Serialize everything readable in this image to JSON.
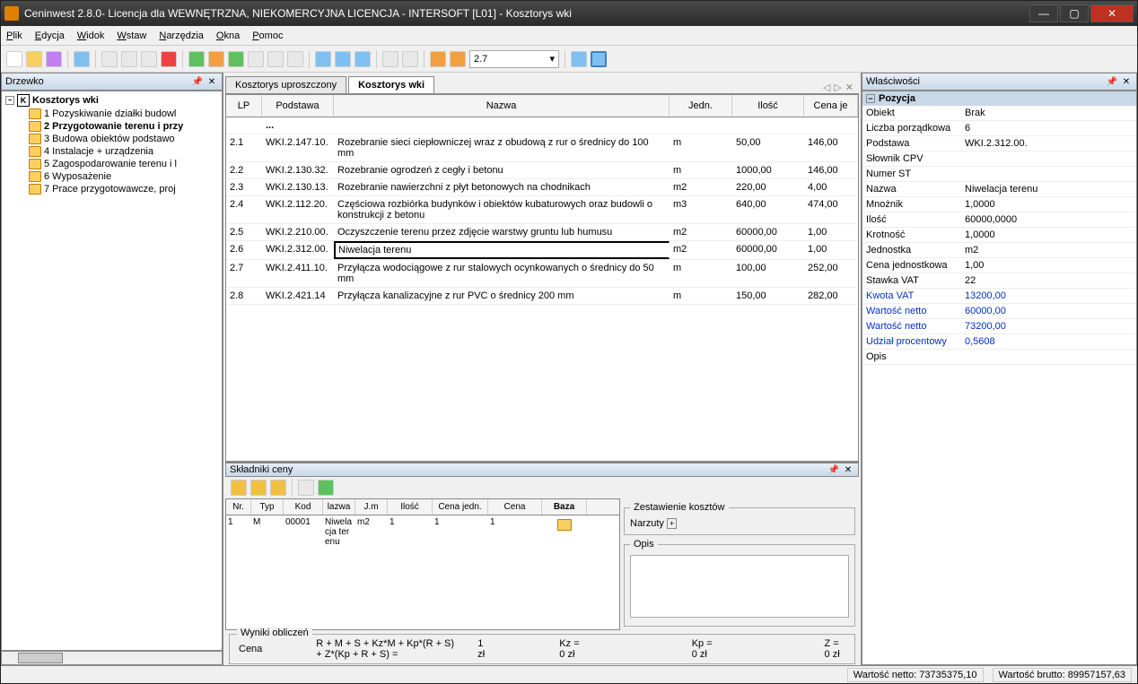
{
  "window": {
    "title": "Ceninwest 2.8.0- Licencja dla WEWNĘTRZNA, NIEKOMERCYJNA LICENCJA - INTERSOFT [L01] - Kosztorys wki"
  },
  "menu": [
    "Plik",
    "Edycja",
    "Widok",
    "Wstaw",
    "Narzędzia",
    "Okna",
    "Pomoc"
  ],
  "toolbar_combo": "2.7",
  "tree": {
    "title": "Drzewko",
    "root": "Kosztorys wki",
    "items": [
      "1 Pozyskiwanie działki budowl",
      "2 Przygotowanie terenu i przy",
      "3 Budowa obiektów podstawo",
      "4 Instalacje + urządzenia",
      "5 Zagospodarowanie terenu i l",
      "6 Wyposażenie",
      "7 Prace przygotowawcze, proj"
    ]
  },
  "tabs": {
    "t1": "Kosztorys uproszczony",
    "t2": "Kosztorys wki"
  },
  "grid": {
    "headers": {
      "lp": "LP",
      "pod": "Podstawa",
      "naz": "Nazwa",
      "jed": "Jedn.",
      "ilo": "Ilość",
      "cen": "Cena je"
    },
    "dots": "...",
    "rows": [
      {
        "lp": "2.1",
        "pod": "WKI.2.147.10.",
        "naz": "Rozebranie sieci ciepłowniczej wraz   z obudową z rur o średnicy do 100 mm",
        "jed": "m",
        "ilo": "50,00",
        "cen": "146,00"
      },
      {
        "lp": "2.2",
        "pod": "WKI.2.130.32.",
        "naz": "Rozebranie ogrodzeń z cegły i betonu",
        "jed": "m",
        "ilo": "1000,00",
        "cen": "146,00"
      },
      {
        "lp": "2.3",
        "pod": "WKI.2.130.13.",
        "naz": "Rozebranie nawierzchni z płyt betonowych na chodnikach",
        "jed": "m2",
        "ilo": "220,00",
        "cen": "4,00"
      },
      {
        "lp": "2.4",
        "pod": "WKI.2.112.20.",
        "naz": "Częściowa rozbiórka budynków i obiektów kubaturowych oraz budowli o konstrukcji z betonu",
        "jed": "m3",
        "ilo": "640,00",
        "cen": "474,00"
      },
      {
        "lp": "2.5",
        "pod": "WKI.2.210.00.",
        "naz": "Oczyszczenie terenu przez zdjęcie warstwy gruntu lub humusu",
        "jed": "m2",
        "ilo": "60000,00",
        "cen": "1,00"
      },
      {
        "lp": "2.6",
        "pod": "WKI.2.312.00.",
        "naz": "Niwelacja terenu",
        "jed": "m2",
        "ilo": "60000,00",
        "cen": "1,00",
        "sel": true
      },
      {
        "lp": "2.7",
        "pod": "WKI.2.411.10.",
        "naz": "Przyłącza wodociągowe z rur stalowych ocynkowanych o średnicy do 50 mm",
        "jed": "m",
        "ilo": "100,00",
        "cen": "252,00"
      },
      {
        "lp": "2.8",
        "pod": "WKI.2.421.14",
        "naz": "Przyłącza kanalizacyjne z rur PVC o średnicy 200 mm",
        "jed": "m",
        "ilo": "150,00",
        "cen": "282,00"
      }
    ]
  },
  "skladniki": {
    "title": "Składniki ceny",
    "headers": {
      "nr": "Nr.",
      "typ": "Typ",
      "kod": "Kod",
      "naz": "lazwa",
      "jm": "J.m",
      "ilo": "Ilość",
      "cj": "Cena jedn.",
      "cena": "Cena",
      "baza": "Baza"
    },
    "row": {
      "nr": "1",
      "typ": "M",
      "kod": "00001",
      "naz": "Niwelacja terenu",
      "jm": "m2",
      "ilo": "1",
      "cj": "1",
      "cena": "1"
    },
    "zest": "Zestawienie kosztów",
    "narzuty": "Narzuty",
    "opis": "Opis"
  },
  "wyniki": {
    "title": "Wyniki obliczeń",
    "cena_label": "Cena",
    "formula": "R + M + S + Kz*M + Kp*(R + S) + Z*(Kp + R + S) =",
    "val": "1 zł",
    "kz": "Kz = 0 zł",
    "kp": "Kp = 0 zł",
    "z": "Z = 0 zł"
  },
  "props": {
    "title": "Właściwości",
    "section": "Pozycja",
    "rows": [
      {
        "k": "Obiekt",
        "v": "Brak"
      },
      {
        "k": "Liczba porządkowa",
        "v": "6"
      },
      {
        "k": "Podstawa",
        "v": "WKI.2.312.00."
      },
      {
        "k": "Słownik CPV",
        "v": ""
      },
      {
        "k": "Numer ST",
        "v": ""
      },
      {
        "k": "Nazwa",
        "v": "Niwelacja terenu"
      },
      {
        "k": "Mnożnik",
        "v": "1,0000"
      },
      {
        "k": "Ilość",
        "v": "60000,0000"
      },
      {
        "k": "Krotność",
        "v": "1,0000"
      },
      {
        "k": "Jednostka",
        "v": "m2"
      },
      {
        "k": "Cena jednostkowa",
        "v": "1,00"
      },
      {
        "k": "Stawka VAT",
        "v": "22"
      },
      {
        "k": "Kwota VAT",
        "v": "13200,00",
        "blue": true
      },
      {
        "k": "Wartość netto",
        "v": "60000,00",
        "blue": true
      },
      {
        "k": "Wartość netto",
        "v": "73200,00",
        "blue": true
      },
      {
        "k": "Udział procentowy",
        "v": "0,5608",
        "blue": true
      },
      {
        "k": "Opis",
        "v": ""
      }
    ]
  },
  "status": {
    "netto": "Wartość netto: 73735375,10",
    "brutto": "Wartość brutto: 89957157,63"
  }
}
